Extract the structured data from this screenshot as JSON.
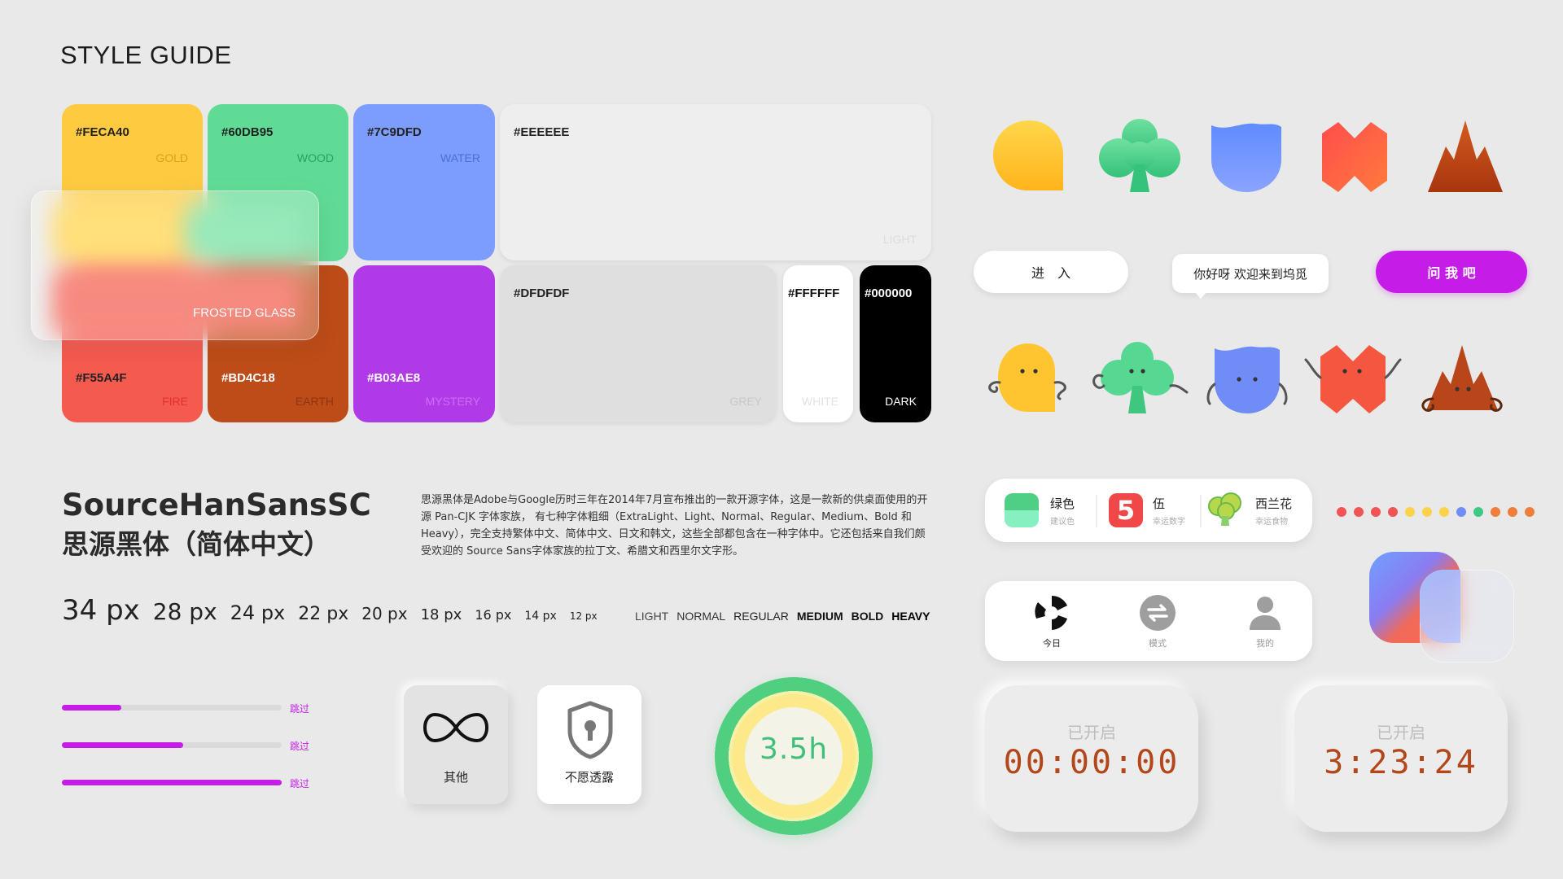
{
  "title": "STYLE GUIDE",
  "swatches": {
    "gold": {
      "hex": "#FECA40",
      "name": "GOLD",
      "color": "#FECA40",
      "label_color": "#d9a21a"
    },
    "wood": {
      "hex": "#60DB95",
      "name": "WOOD",
      "color": "#60DB95",
      "label_color": "#2aa35c"
    },
    "water": {
      "hex": "#7C9DFD",
      "name": "WATER",
      "color": "#7C9DFD",
      "label_color": "#4d6ed8"
    },
    "light": {
      "hex": "#EEEEEE",
      "name": "LIGHT",
      "color": "#EEEEEE"
    },
    "fire": {
      "hex": "#F55A4F",
      "name": "FIRE",
      "color": "#F55A4F",
      "label_color": "#e0322a"
    },
    "earth": {
      "hex": "#BD4C18",
      "name": "EARTH",
      "color": "#BD4C18",
      "label_color": "#8e3510"
    },
    "mystery": {
      "hex": "#B03AE8",
      "name": "MYSTERY",
      "color": "#B03AE8",
      "label_color": "#d06cf2"
    },
    "grey": {
      "hex": "#DFDFDF",
      "name": "GREY",
      "color": "#DFDFDF"
    },
    "white": {
      "hex": "#FFFFFF",
      "name": "WHITE",
      "color": "#FFFFFF"
    },
    "dark": {
      "hex": "#000000",
      "name": "DARK",
      "color": "#000000"
    }
  },
  "frosted_glass_label": "FROSTED GLASS",
  "font": {
    "name_en": "SourceHanSansSC",
    "name_cn": "思源黑体（简体中文）",
    "description": "思源黑体是Adobe与Google历时三年在2014年7月宣布推出的一款开源字体，这是一款新的供桌面使用的开源 Pan-CJK 字体家族， 有七种字体粗细（ExtraLight、Light、Normal、Regular、Medium、Bold 和 Heavy），完全支持繁体中文、简体中文、日文和韩文，这些全部都包含在一种字体中。它还包括来自我们颇受欢迎的 Source Sans字体家族的拉丁文、希腊文和西里尔文字形。",
    "sizes": [
      "34 px",
      "28 px",
      "24 px",
      "22 px",
      "20 px",
      "18 px",
      "16 px",
      "14 px",
      "12 px"
    ],
    "weights": [
      "LIGHT",
      "NORMAL",
      "REGULAR",
      "MEDIUM",
      "BOLD",
      "HEAVY"
    ]
  },
  "progress": {
    "bars": [
      {
        "fraction": 0.27,
        "label": "跳过"
      },
      {
        "fraction": 0.55,
        "label": "跳过"
      },
      {
        "fraction": 1.0,
        "label": "跳过"
      }
    ]
  },
  "cards": {
    "other": "其他",
    "private": "不愿透露"
  },
  "ring": {
    "value": "3.5h"
  },
  "buttons": {
    "enter": "进　入",
    "greeting": "你好呀 欢迎来到坞觅",
    "ask": "问 我 吧"
  },
  "lucky": {
    "color_title": "绿色",
    "color_sub": "建议色",
    "number": "5",
    "number_title": "伍",
    "number_sub": "幸运数字",
    "food_title": "西兰花",
    "food_sub": "幸运食物"
  },
  "dots": [
    "#f05454",
    "#f05454",
    "#f05454",
    "#f05454",
    "#fbd34a",
    "#fbd34a",
    "#fbd34a",
    "#6f8cf7",
    "#3ec983",
    "#ef7d3c",
    "#ef7d3c",
    "#ef7d3c"
  ],
  "tabbar": {
    "today": "今日",
    "mode": "模式",
    "mine": "我的"
  },
  "timers": [
    {
      "label": "已开启",
      "value": "00:00:00"
    },
    {
      "label": "已开启",
      "value": "3:23:24"
    }
  ]
}
